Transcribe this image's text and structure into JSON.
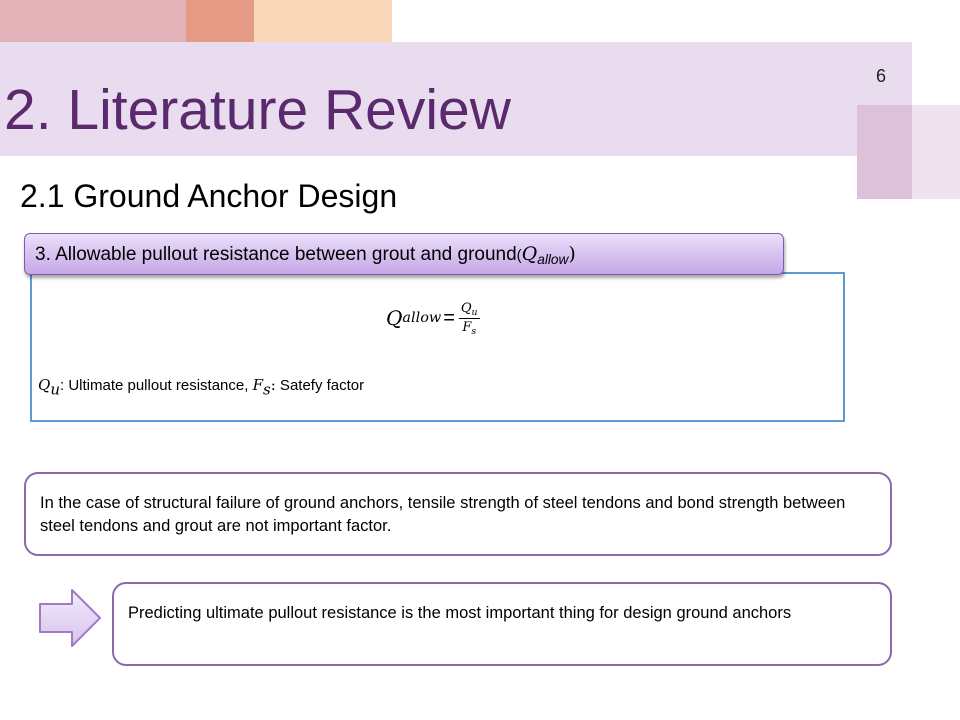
{
  "slide": {
    "number": "6",
    "title": "2. Literature Review",
    "section_heading": "2.1 Ground Anchor Design"
  },
  "item_banner": {
    "text": "3. Allowable pullout resistance between grout and ground",
    "paren_open": "(",
    "symbol_main": "Q",
    "symbol_sub": "allow",
    "paren_close": ")"
  },
  "formula": {
    "lhs_main": "Q",
    "lhs_sub": "allow",
    "equals": "=",
    "numerator_main": "Q",
    "numerator_sub": "u",
    "denominator_main": "F",
    "denominator_sub": "s"
  },
  "definitions": {
    "qu_main": "Q",
    "qu_sub": "u",
    "qu_text": ": Ultimate pullout resistance,",
    "fs_main": "F",
    "fs_sub": "s",
    "fs_colon": ":",
    "fs_text": " Satefy factor"
  },
  "failure_note": "In the case of structural failure of ground anchors, tensile strength of steel tendons and bond strength between steel tendons and grout are not important factor.",
  "conclusion": "Predicting ultimate pullout resistance is the most important thing for design ground anchors",
  "colors": {
    "title": "#5b2a6e",
    "title_band": "#e8dcee",
    "box_border": "#8a6aa8",
    "formula_border": "#5b9bd5"
  },
  "icons": {
    "arrow": "right-arrow-icon"
  }
}
